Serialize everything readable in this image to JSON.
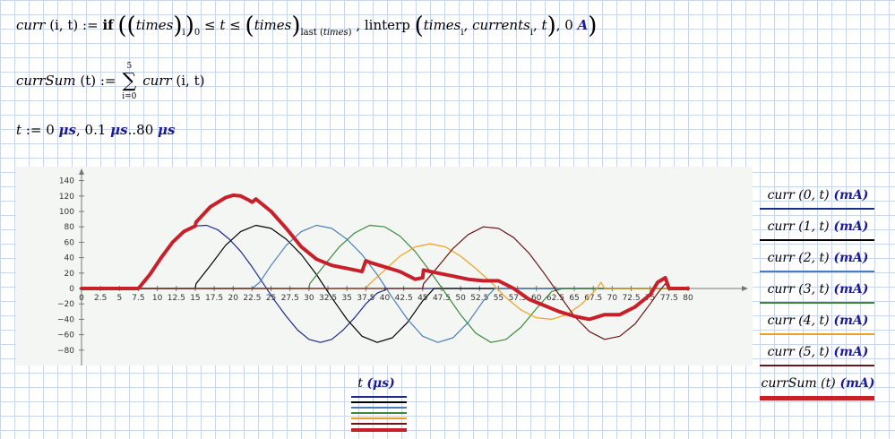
{
  "definitions": {
    "curr": {
      "lhs_name": "curr",
      "lhs_args": "(i, t)",
      "assign": ":=",
      "if_kw": "if",
      "times": "times",
      "sub_i": "i",
      "sub_0": "0",
      "le": "≤",
      "t": "t",
      "sub_last": "last",
      "linterp": "linterp",
      "currents": "currents",
      "zero": "0",
      "unit_A": "A"
    },
    "currSum": {
      "lhs_name": "currSum",
      "lhs_args": "(t)",
      "assign": ":=",
      "sum_top": "5",
      "sum_bottom": "i=0",
      "rhs": "curr",
      "rhs_args": "(i, t)"
    },
    "range": {
      "var": "t",
      "assign": ":=",
      "start": "0",
      "step": "0.1",
      "sep": "..",
      "end": "80",
      "unit": "μs"
    }
  },
  "legend": [
    {
      "label": "curr (0, t)",
      "unit": "(mA)",
      "color": "#1c2a8a"
    },
    {
      "label": "curr (1, t)",
      "unit": "(mA)",
      "color": "#000000"
    },
    {
      "label": "curr (2, t)",
      "unit": "(mA)",
      "color": "#4a7fb5"
    },
    {
      "label": "curr (3, t)",
      "unit": "(mA)",
      "color": "#3a8a3a"
    },
    {
      "label": "curr (4, t)",
      "unit": "(mA)",
      "color": "#f0a020"
    },
    {
      "label": "curr (5, t)",
      "unit": "(mA)",
      "color": "#6b1515"
    },
    {
      "label": "currSum (t)",
      "unit": "(mA)",
      "color": "#c8202a"
    }
  ],
  "x_axis_label": "t",
  "x_axis_unit": "(μs)",
  "chart_data": {
    "type": "line",
    "xlabel": "t (μs)",
    "ylabel": "",
    "xlim": [
      0,
      80
    ],
    "ylim": [
      -100,
      160
    ],
    "x_ticks": [
      "0",
      "2.5",
      "5",
      "7.5",
      "10",
      "12.5",
      "15",
      "17.5",
      "20",
      "22.5",
      "25",
      "27.5",
      "30",
      "32.5",
      "35",
      "37.5",
      "40",
      "42.5",
      "45",
      "47.5",
      "50",
      "52.5",
      "55",
      "57.5",
      "60",
      "62.5",
      "65",
      "67.5",
      "70",
      "72.5",
      "75",
      "77.5",
      "80"
    ],
    "y_ticks": [
      "140",
      "120",
      "100",
      "80",
      "60",
      "40",
      "20",
      "0",
      "−20",
      "−40",
      "−60",
      "−80"
    ],
    "series": [
      {
        "name": "curr (0, t)",
        "color": "#1c2a8a",
        "width": 1.2,
        "x": [
          0,
          7.5,
          9,
          10.5,
          12,
          13.5,
          15,
          16.5,
          18,
          19.5,
          21,
          22.5,
          24,
          25.5,
          27,
          28.5,
          30,
          31.5,
          33,
          34.5,
          36,
          37.5,
          39,
          40.5,
          42,
          80
        ],
        "y": [
          0,
          0,
          18,
          40,
          60,
          74,
          81,
          82,
          76,
          64,
          48,
          28,
          6,
          -16,
          -36,
          -54,
          -66,
          -70,
          -66,
          -54,
          -38,
          -20,
          -6,
          0,
          0,
          0
        ]
      },
      {
        "name": "curr (1, t)",
        "color": "#000000",
        "width": 1.2,
        "x": [
          0,
          15,
          15.1,
          17,
          19,
          21,
          23,
          25,
          27,
          29,
          31,
          33,
          35,
          37,
          39,
          41,
          43,
          45,
          46.5,
          80
        ],
        "y": [
          0,
          0,
          6,
          30,
          56,
          74,
          82,
          78,
          64,
          44,
          18,
          -12,
          -40,
          -62,
          -70,
          -64,
          -44,
          -16,
          0,
          0
        ]
      },
      {
        "name": "curr (2, t)",
        "color": "#4a7fb5",
        "width": 1.2,
        "x": [
          0,
          22.5,
          23.5,
          25,
          27,
          29,
          31,
          33,
          35,
          37,
          39,
          41,
          43,
          45,
          47,
          49,
          51,
          53,
          54.5,
          80
        ],
        "y": [
          0,
          0,
          8,
          30,
          56,
          74,
          82,
          78,
          64,
          44,
          18,
          -12,
          -40,
          -62,
          -70,
          -64,
          -44,
          -16,
          0,
          0
        ]
      },
      {
        "name": "curr (3, t)",
        "color": "#3a8a3a",
        "width": 1.2,
        "x": [
          0,
          30,
          30.1,
          32,
          34,
          36,
          38,
          40,
          42,
          44,
          46,
          48,
          50,
          52,
          54,
          56,
          58,
          60,
          62,
          63.5,
          80
        ],
        "y": [
          0,
          0,
          6,
          30,
          54,
          72,
          82,
          80,
          68,
          48,
          22,
          -6,
          -34,
          -58,
          -70,
          -66,
          -50,
          -26,
          -4,
          0,
          0
        ]
      },
      {
        "name": "curr (4, t)",
        "color": "#f0a020",
        "width": 1.2,
        "x": [
          0,
          37.5,
          38,
          40,
          42,
          44,
          46,
          48,
          50,
          52,
          54,
          56,
          58,
          60,
          62,
          64,
          66,
          68,
          68.5,
          69,
          80
        ],
        "y": [
          0,
          0,
          6,
          24,
          42,
          54,
          58,
          54,
          42,
          26,
          8,
          -12,
          -28,
          -38,
          -40,
          -34,
          -20,
          0,
          8,
          0,
          0
        ]
      },
      {
        "name": "curr (5, t)",
        "color": "#6b1515",
        "width": 1.2,
        "x": [
          0,
          45,
          45.1,
          47,
          49,
          51,
          53,
          55,
          57,
          59,
          61,
          63,
          65,
          67,
          69,
          71,
          73,
          75,
          76,
          77,
          77.5,
          80
        ],
        "y": [
          0,
          0,
          6,
          28,
          52,
          70,
          80,
          78,
          66,
          46,
          20,
          -8,
          -36,
          -56,
          -66,
          -62,
          -46,
          -20,
          -6,
          6,
          0,
          0
        ]
      },
      {
        "name": "currSum (t)",
        "color": "#c8202a",
        "width": 4,
        "x": [
          0,
          7.5,
          9,
          10.5,
          12,
          13.5,
          15,
          15.1,
          17,
          19,
          20,
          21,
          22,
          22.5,
          23,
          25,
          27,
          29,
          31,
          33,
          35,
          37,
          37.5,
          38,
          40,
          42,
          44,
          45,
          45.1,
          47,
          49,
          51,
          53,
          55,
          57,
          59,
          61,
          63,
          65,
          67,
          69,
          71,
          73,
          75,
          76,
          77,
          77.5,
          80
        ],
        "y": [
          0,
          0,
          18,
          40,
          60,
          74,
          81,
          86,
          106,
          118,
          121,
          120,
          115,
          112,
          116,
          100,
          78,
          54,
          38,
          30,
          26,
          22,
          36,
          34,
          28,
          22,
          12,
          14,
          24,
          20,
          16,
          12,
          10,
          10,
          0,
          -14,
          -22,
          -30,
          -36,
          -40,
          -34,
          -34,
          -24,
          -8,
          8,
          14,
          0,
          0
        ]
      }
    ]
  }
}
